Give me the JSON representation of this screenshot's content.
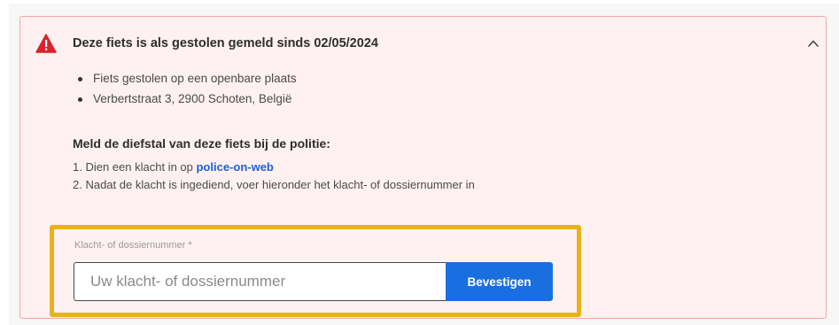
{
  "alert": {
    "title": "Deze fiets is als gestolen gemeld sinds 02/05/2024",
    "icon": "warning-triangle-icon",
    "collapse_icon": "chevron-up-icon",
    "color": "#d9232e",
    "details": [
      "Fiets gestolen op een openbare plaats",
      "Verbertstraat 3, 2900 Schoten, België"
    ]
  },
  "report": {
    "heading": "Meld de diefstal van deze fiets bij de politie:",
    "step1_prefix": "1. Dien een klacht in op ",
    "step1_link": "police-on-web",
    "step2": "2. Nadat de klacht is ingediend, voer hieronder het klacht- of dossiernummer in"
  },
  "form": {
    "label": "Klacht- of dossiernummer *",
    "value": "",
    "placeholder": "Uw klacht- of dossiernummer",
    "submit_label": "Bevestigen",
    "accent_color": "#1a6fe0",
    "highlight_color": "#e9b21a"
  }
}
